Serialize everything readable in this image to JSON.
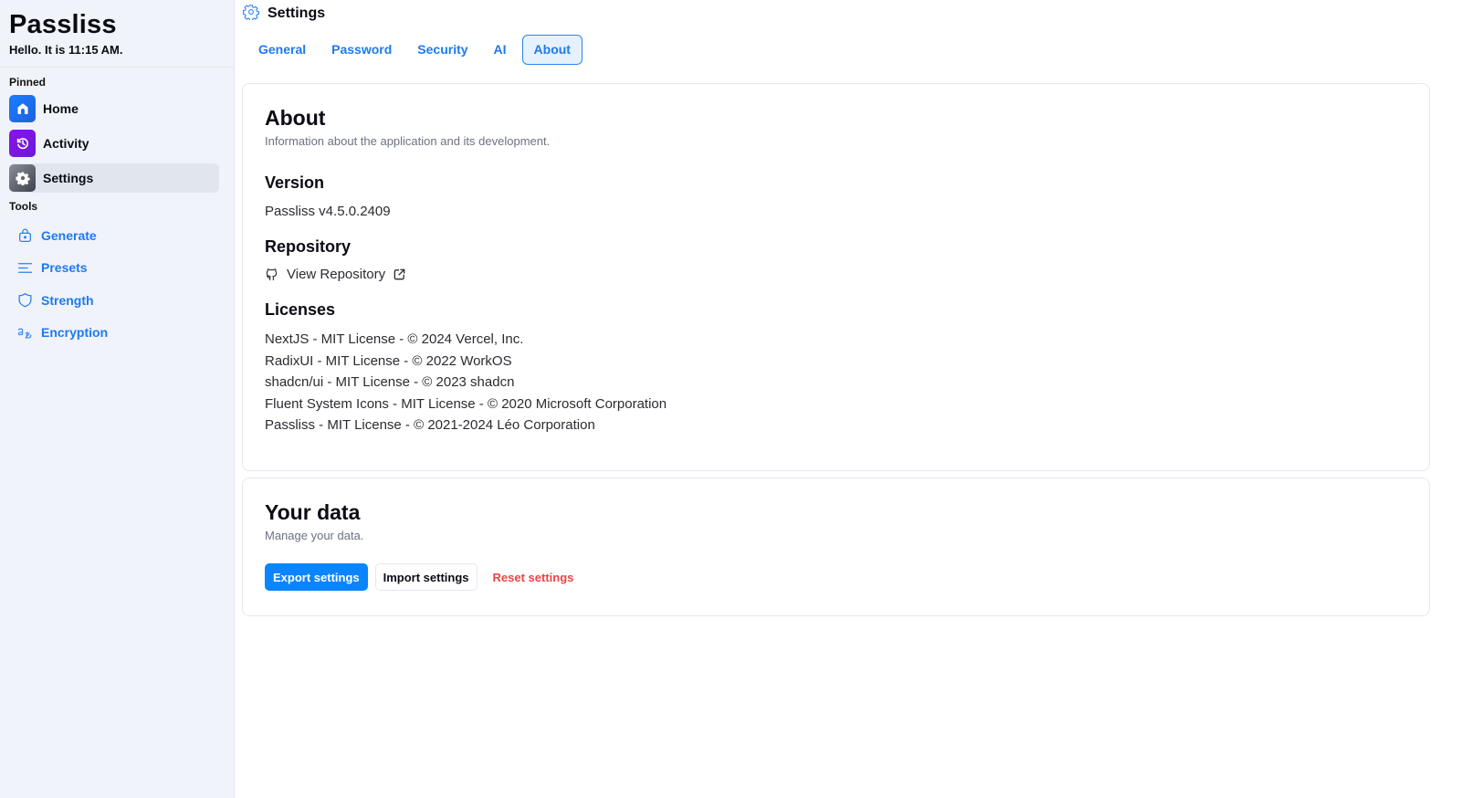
{
  "app": {
    "name": "Passliss",
    "greeting": "Hello. It is 11:15 AM."
  },
  "sidebar": {
    "pinned_label": "Pinned",
    "pinned": [
      {
        "label": "Home",
        "icon": "home-icon",
        "active": false
      },
      {
        "label": "Activity",
        "icon": "history-icon",
        "active": false
      },
      {
        "label": "Settings",
        "icon": "gear-icon",
        "active": true
      }
    ],
    "tools_label": "Tools",
    "tools": [
      {
        "label": "Generate",
        "icon": "lock-icon"
      },
      {
        "label": "Presets",
        "icon": "text-align-icon"
      },
      {
        "label": "Strength",
        "icon": "shield-icon"
      },
      {
        "label": "Encryption",
        "icon": "translate-icon"
      }
    ]
  },
  "header": {
    "title": "Settings",
    "icon": "gear-icon"
  },
  "tabs": [
    {
      "label": "General",
      "active": false
    },
    {
      "label": "Password",
      "active": false
    },
    {
      "label": "Security",
      "active": false
    },
    {
      "label": "AI",
      "active": false
    },
    {
      "label": "About",
      "active": true
    }
  ],
  "about": {
    "title": "About",
    "subtitle": "Information about the application and its development.",
    "version_title": "Version",
    "version": "Passliss v4.5.0.2409",
    "repo_title": "Repository",
    "repo_link": "View Repository",
    "licenses_title": "Licenses",
    "licenses": [
      "NextJS - MIT License - © 2024 Vercel, Inc.",
      "RadixUI - MIT License - © 2022 WorkOS",
      "shadcn/ui - MIT License - © 2023 shadcn",
      "Fluent System Icons - MIT License - © 2020 Microsoft Corporation",
      "Passliss - MIT License - © 2021-2024 Léo Corporation"
    ]
  },
  "your_data": {
    "title": "Your data",
    "subtitle": "Manage your data.",
    "export_label": "Export settings",
    "import_label": "Import settings",
    "reset_label": "Reset settings"
  },
  "colors": {
    "accent": "#0a84ff",
    "link": "#1d7af0",
    "danger": "#ef4444",
    "sidebar_bg": "#f0f3f9"
  }
}
